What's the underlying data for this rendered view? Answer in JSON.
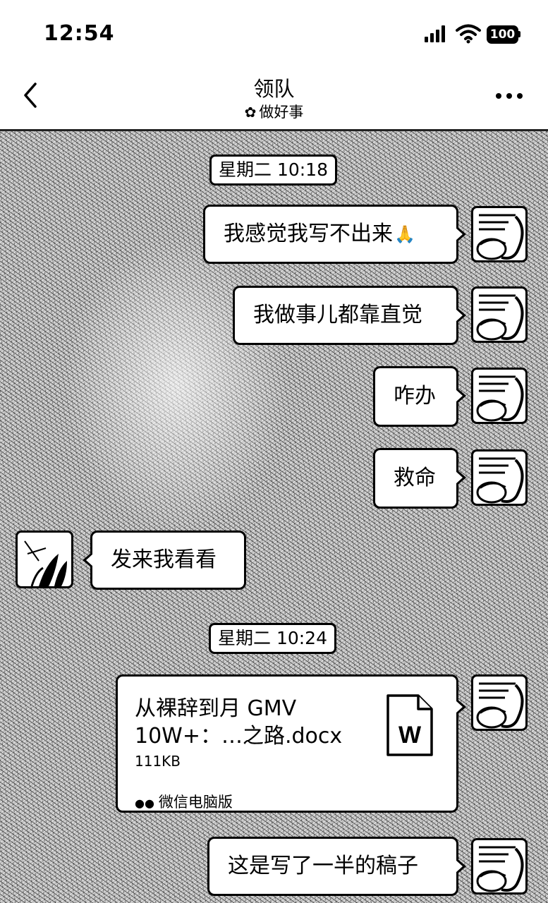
{
  "status_bar": {
    "time": "12:54",
    "battery": "100",
    "icons": [
      "cellular-signal-icon",
      "wifi-icon",
      "battery-icon"
    ]
  },
  "nav": {
    "back_icon": "chevron-left-icon",
    "title": "领队",
    "subtitle": "做好事",
    "subtitle_icon": "flower-icon",
    "more_icon": "more-dots-icon"
  },
  "messages": {
    "stamp_1": "星期二 10:18",
    "m1": "我感觉我写不出来",
    "m1_emoji": "🙏",
    "m2": "我做事儿都靠直觉",
    "m3": "咋办",
    "m4": "救命",
    "m5": "发来我看看",
    "stamp_2": "星期二 10:24",
    "file": {
      "name": "从裸辞到月 GMV 10W+：…之路.docx",
      "size": "111KB",
      "source": "微信电脑版",
      "icon": "word-document-icon"
    },
    "m6": "这是写了一半的稿子"
  },
  "colors": {
    "bubble": "#ffffff",
    "border": "#000000",
    "text": "#000000"
  }
}
